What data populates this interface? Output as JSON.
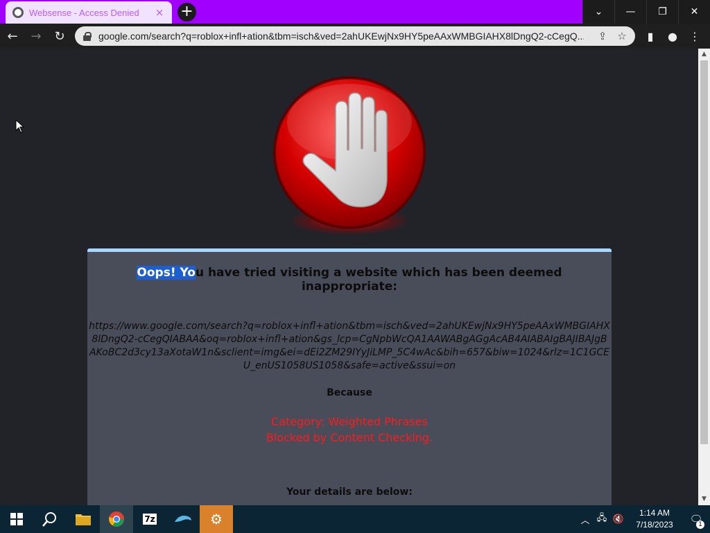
{
  "browser": {
    "tab_title": "Websense - Access Denied",
    "tab_close": "×",
    "new_tab": "+",
    "window_controls": {
      "tab_search": "⌄",
      "minimize": "—",
      "restore": "❐",
      "close": "✕"
    },
    "url": "google.com/search?q=roblox+infl+ation&tbm=isch&ved=2ahUKEwjNx9HY5peAAxWMBGIAHX8lDngQ2-cCegQ..."
  },
  "block_page": {
    "headline_selected": "Oops! Yo",
    "headline_rest": "u have tried visiting a website which has been deemed inappropriate:",
    "blocked_url": "https://www.google.com/search?q=roblox+infl+ation&tbm=isch&ved=2ahUKEwjNx9HY5peAAxWMBGIAHX8lDngQ2-cCegQIABAA&oq=roblox+infl+ation&gs_lcp=CgNpbWcQA1AAWABgAGgAcAB4AIABAIgBAJIBAJgBAKoBC2d3cy13aXotaW1n&sclient=img&ei=dEi2ZM29IYyJiLMP_5C4wAc&bih=657&biw=1024&rlz=1C1GCEU_enUS1058US1058&safe=active&ssui=on",
    "because": "Because",
    "category": "Category: Weighted Phrases",
    "reason": "Blocked by Content Checking.",
    "details": "Your details are below:"
  },
  "taskbar": {
    "apps": [
      "start",
      "search",
      "file-explorer",
      "chrome",
      "7-zip",
      "dolphin",
      "settings"
    ],
    "seven_zip_label": "7z",
    "time": "1:14 AM",
    "date": "7/18/2023",
    "notification_count": "1"
  },
  "colors": {
    "title_bar": "#a100ff",
    "panel": "#494d5a",
    "reason_text": "#ff1a1a",
    "selection": "#1d5fd1"
  }
}
